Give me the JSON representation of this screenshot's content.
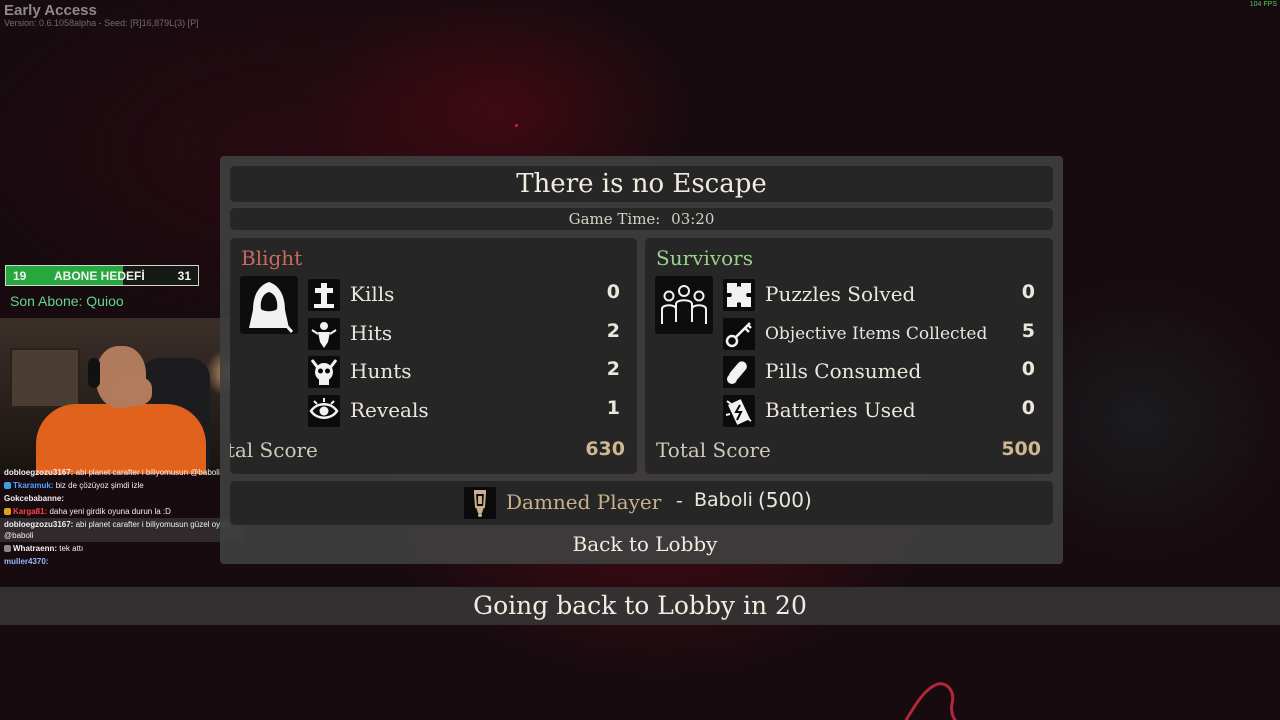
{
  "hud": {
    "early_access": "Early Access",
    "version_line": "Version: 0.6.1058alpha - Seed: [R]16,879L(3) [P]",
    "fps": "104 FPS"
  },
  "overlay": {
    "sub_goal": {
      "current": "19",
      "label": "ABONE HEDEFİ",
      "target": "31",
      "progress_fraction": 0.61,
      "fill_color": "#27a83f"
    },
    "last_sub": "Son Abone: Quioo"
  },
  "chat": [
    {
      "user": "dobloegzozu3167:",
      "text": "abi planet carafter i biliyomusun @baboli",
      "color": "#f1f1f1",
      "badge": ""
    },
    {
      "user": "Tkaramuk:",
      "text": "biz de çözüyoz şimdi izle",
      "color": "#4fa3ff",
      "badge": "#3da0e0"
    },
    {
      "user": "Gokcebabanne:",
      "text": "",
      "color": "#f1f1f1",
      "badge": ""
    },
    {
      "user": "Karga81:",
      "text": "daha yeni girdik oyuna durun la :D",
      "color": "#ff4545",
      "badge": "#e0a020"
    },
    {
      "user": "dobloegzozu3167:",
      "text": "abi planet carafter i biliyomusun güzel oyun @baboli",
      "color": "#f1f1f1",
      "badge": ""
    },
    {
      "user": "Whatraenn:",
      "text": "tek attı",
      "color": "#f1f1f1",
      "badge": "#888888"
    },
    {
      "user": "muller4370:",
      "text": "",
      "color": "#9ab8ff",
      "badge": ""
    }
  ],
  "results": {
    "title": "There is no Escape",
    "game_time_label": "Game Time:",
    "game_time": "03:20",
    "blight": {
      "name": "Blight",
      "stats": [
        {
          "icon": "tombstone-icon",
          "label": "Kills",
          "value": "0"
        },
        {
          "icon": "grab-icon",
          "label": "Hits",
          "value": "2"
        },
        {
          "icon": "horned-skull-icon",
          "label": "Hunts",
          "value": "2"
        },
        {
          "icon": "eye-icon",
          "label": "Reveals",
          "value": "1"
        }
      ],
      "total_label": "Total Score",
      "total": "630"
    },
    "survivors": {
      "name": "Survivors",
      "stats": [
        {
          "icon": "puzzle-icon",
          "label": "Puzzles Solved",
          "value": "0"
        },
        {
          "icon": "key-icon",
          "label": "Objective Items Collected",
          "value": "5"
        },
        {
          "icon": "pills-icon",
          "label": "Pills Consumed",
          "value": "0"
        },
        {
          "icon": "battery-icon",
          "label": "Batteries Used",
          "value": "0"
        }
      ],
      "total_label": "Total Score",
      "total": "500"
    },
    "damned": {
      "label": "Damned Player",
      "dash": "-",
      "player": "Baboli",
      "score": "(500)"
    },
    "back_label": "Back to Lobby"
  },
  "countdown": "Going back to Lobby in 20"
}
